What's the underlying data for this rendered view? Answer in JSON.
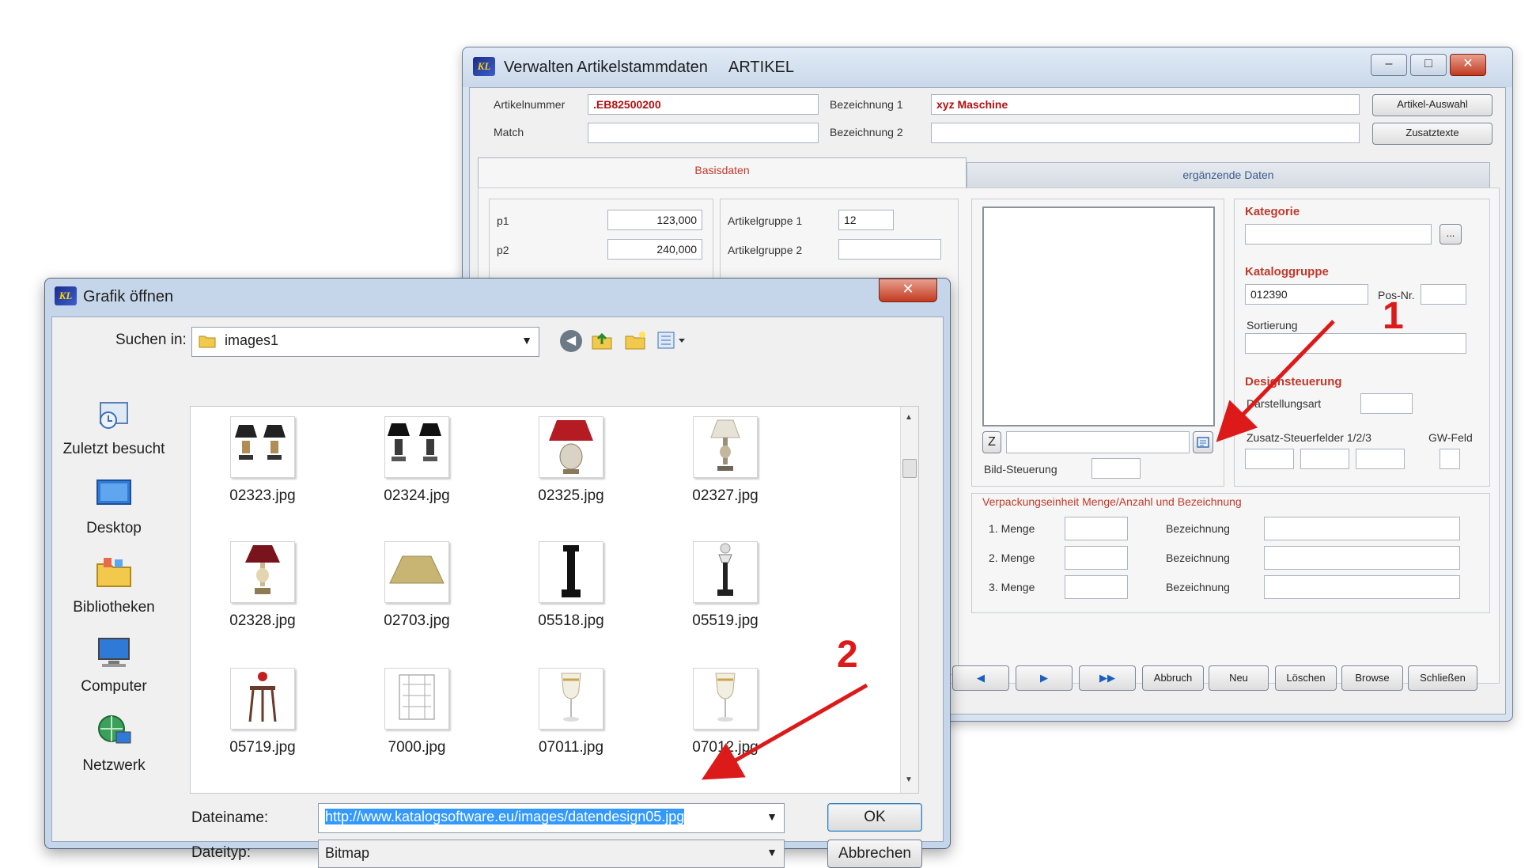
{
  "main_window": {
    "title": "Verwalten Artikelstammdaten",
    "module": "ARTIKEL",
    "caption_buttons": {
      "minimize": "‒",
      "maximize": "□",
      "close": "✕"
    },
    "header": {
      "artikelnummer_label": "Artikelnummer",
      "artikelnummer_value": ".EB82500200",
      "match_label": "Match",
      "match_value": "",
      "bez1_label": "Bezeichnung 1",
      "bez1_value": "xyz Maschine",
      "bez2_label": "Bezeichnung 2",
      "bez2_value": "",
      "artikel_auswahl_button": "Artikel-Auswahl",
      "zusatztexte_button": "Zusatztexte"
    },
    "tabs": {
      "basisdaten": "Basisdaten",
      "ergaenzende": "ergänzende Daten"
    },
    "basis": {
      "p1_label": "p1",
      "p1_value": "123,000",
      "p2_label": "p2",
      "p2_value": "240,000",
      "ag1_label": "Artikelgruppe 1",
      "ag1_value": "12",
      "ag2_label": "Artikelgruppe 2",
      "ag2_value": ""
    },
    "image_panel": {
      "z_button": "Z",
      "bild_steuerung_label": "Bild-Steuerung"
    },
    "kategorie": {
      "kategorie_label": "Kategorie",
      "katalog_label": "Kataloggruppe",
      "katalog_value": "012390",
      "posnr_label": "Pos-Nr.",
      "sortierung_label": "Sortierung",
      "design_label": "Designsteuerung",
      "darstellungsart_label": "Darstellungsart",
      "zusatz_label": "Zusatz-Steuerfelder 1/2/3",
      "gw_label": "GW-Feld",
      "dots_button": "..."
    },
    "verpackung": {
      "title": "Verpackungseinheit  Menge/Anzahl  und  Bezeichnung",
      "rows": [
        {
          "menge": "1. Menge",
          "bez": "Bezeichnung"
        },
        {
          "menge": "2. Menge",
          "bez": "Bezeichnung"
        },
        {
          "menge": "3. Menge",
          "bez": "Bezeichnung"
        }
      ]
    },
    "nav_buttons": {
      "prev": "◀",
      "next": "▶",
      "last": "▶▶",
      "abbruch": "Abbruch",
      "neu": "Neu",
      "loeschen": "Löschen",
      "browse": "Browse",
      "schliessen": "Schließen"
    }
  },
  "dialog": {
    "title": "Grafik öffnen",
    "close": "✕",
    "suchen_in_label": "Suchen in:",
    "folder": "images1",
    "places": [
      "Zuletzt besucht",
      "Desktop",
      "Bibliotheken",
      "Computer",
      "Netzwerk"
    ],
    "files": [
      "02323.jpg",
      "02324.jpg",
      "02325.jpg",
      "02327.jpg",
      "02328.jpg",
      "02703.jpg",
      "05518.jpg",
      "05519.jpg",
      "05719.jpg",
      "7000.jpg",
      "07011.jpg",
      "07012.jpg"
    ],
    "dateiname_label": "Dateiname:",
    "dateiname_value": "http://www.katalogsoftware.eu/images/datendesign05.jpg",
    "dateityp_label": "Dateityp:",
    "dateityp_value": "Bitmap",
    "ok_button": "OK",
    "cancel_button": "Abbrechen"
  },
  "annotations": {
    "marker1": "1",
    "marker2": "2",
    "color": "#dd1a1a"
  }
}
